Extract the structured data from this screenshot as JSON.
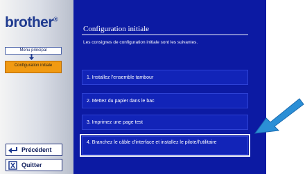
{
  "sidebar": {
    "logo": "brother",
    "logo_mark": "®",
    "menu_link": "Menu principal",
    "current_page": "Configuration initiale",
    "prev_button": "Précédent",
    "quit_button": "Quitter"
  },
  "main": {
    "title": "Configuration initiale",
    "description": "Les consignes de configuration initiale sont les suivantes.",
    "steps": [
      {
        "label": "1. Installez l'ensemble tambour"
      },
      {
        "label": "2. Mettez du papier dans le bac"
      },
      {
        "label": "3. Imprimez une page test"
      },
      {
        "label": "4. Branchez le câble d'interface et installez le pilote/l'utilitaire"
      }
    ]
  },
  "colors": {
    "panel_bg": "#0c1aa3",
    "step_bg": "#1224b8",
    "current_page_bg": "#f19a12",
    "arrow": "#2b8fd6"
  },
  "icons": {
    "prev": "return-arrow-icon",
    "quit": "exit-door-icon",
    "nav_down": "down-arrow-icon",
    "pointer": "pointer-arrow-icon"
  }
}
